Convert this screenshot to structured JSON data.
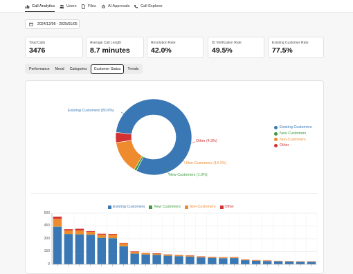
{
  "nav": {
    "tabs": [
      {
        "label": "Call Analytics",
        "icon": "analytics-icon"
      },
      {
        "label": "Users",
        "icon": "users-icon"
      },
      {
        "label": "Files",
        "icon": "file-icon"
      },
      {
        "label": "AI Approvals",
        "icon": "robot-icon"
      },
      {
        "label": "Call Explorer",
        "icon": "phone-icon"
      }
    ]
  },
  "date_range": "2024/12/06 - 2025/01/05",
  "metrics": [
    {
      "label": "Total Calls",
      "value": "3476"
    },
    {
      "label": "Average Call Length",
      "value": "8.7 minutes"
    },
    {
      "label": "Resolution Rate",
      "value": "42.0%"
    },
    {
      "label": "ID Verification Rate",
      "value": "49.5%"
    },
    {
      "label": "Existing Customer Rate",
      "value": "77.5%"
    }
  ],
  "subtabs": [
    "Performance",
    "Mood",
    "Categories",
    "Customer Status",
    "Trends"
  ],
  "colors": {
    "existing": "#3a78b5",
    "new": "#3c9a3c",
    "non": "#ef8b2f",
    "other": "#d23232"
  },
  "chart_data": [
    {
      "type": "pie",
      "variant": "donut",
      "slices": [
        {
          "name": "Existing Customers",
          "value": 80.6,
          "label": "Existing Customers (80.6%)"
        },
        {
          "name": "New Customers",
          "value": 1.0,
          "label": "New Customers (1.0%)"
        },
        {
          "name": "Non-Customers",
          "value": 14.1,
          "label": "Non-Customers (14.1%)"
        },
        {
          "name": "Other",
          "value": 4.3,
          "label": "Other (4.3%)"
        }
      ],
      "legend": [
        "Existing Customers",
        "New Customers",
        "Non-Customers",
        "Other"
      ],
      "legend_position": "right"
    },
    {
      "type": "bar",
      "stacked": true,
      "ylim": [
        0,
        600
      ],
      "yticks": [
        "600",
        "450",
        "300",
        "150",
        "0"
      ],
      "legend_position": "top",
      "series": [
        {
          "name": "Existing Customers",
          "values": [
            440,
            355,
            350,
            345,
            310,
            305,
            210,
            125,
            115,
            110,
            100,
            95,
            90,
            80,
            75,
            70,
            72,
            48,
            42,
            38,
            35,
            32,
            30,
            30
          ]
        },
        {
          "name": "New Customers",
          "values": [
            3,
            2,
            2,
            2,
            2,
            2,
            2,
            1,
            1,
            1,
            1,
            1,
            1,
            1,
            1,
            1,
            1,
            0,
            0,
            0,
            0,
            0,
            0,
            0
          ]
        },
        {
          "name": "Non-Customers",
          "values": [
            90,
            40,
            45,
            35,
            35,
            40,
            35,
            20,
            15,
            15,
            12,
            12,
            12,
            10,
            10,
            10,
            10,
            8,
            6,
            6,
            5,
            5,
            5,
            5
          ]
        },
        {
          "name": "Other",
          "values": [
            25,
            15,
            20,
            8,
            12,
            10,
            5,
            5,
            2,
            4,
            3,
            2,
            3,
            3,
            2,
            2,
            2,
            2,
            2,
            2,
            1,
            1,
            1,
            1
          ]
        }
      ]
    }
  ]
}
